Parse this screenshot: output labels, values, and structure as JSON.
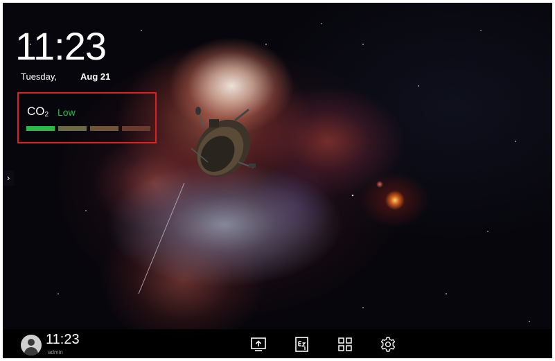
{
  "clock": {
    "time": "11:23",
    "day": "Tuesday,",
    "date": "Aug 21"
  },
  "co2_widget": {
    "label": "CO",
    "subscript": "2",
    "level_text": "Low",
    "level_color": "#2fb84a",
    "highlight_color": "#e31e1e",
    "levels_total": 4,
    "levels_active": 1,
    "bar_colors": [
      "#2fb84a",
      "#6a6a44",
      "#6f5538",
      "#6b3a2e"
    ]
  },
  "side_panel": {
    "toggle_icon": "chevron-right-icon",
    "toggle_glyph": "›"
  },
  "taskbar": {
    "user_time": "11:23",
    "user_name": "admin",
    "icons": [
      "screen-share-icon",
      "ez-write-icon",
      "apps-grid-icon",
      "settings-gear-icon"
    ]
  },
  "colors": {
    "background": "#07060c",
    "taskbar": "#000000",
    "text": "#ffffff"
  }
}
